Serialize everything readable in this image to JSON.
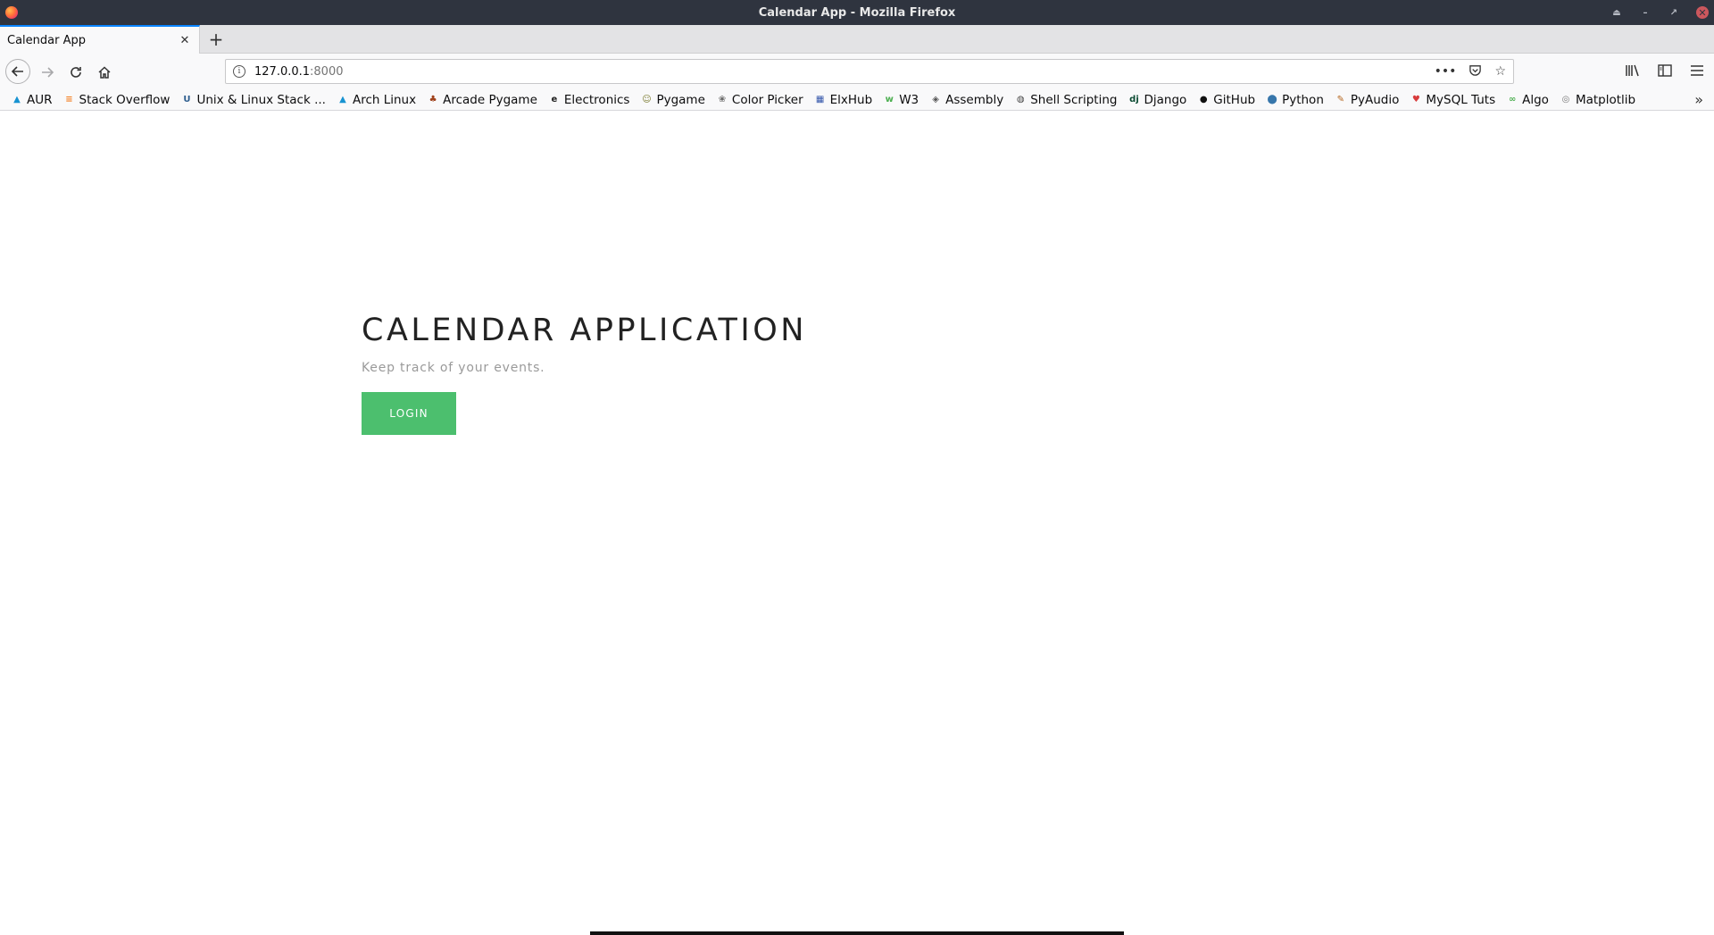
{
  "window": {
    "title": "Calendar App - Mozilla Firefox",
    "buttons": [
      "⏏",
      "–",
      "↗",
      "✕"
    ]
  },
  "tabs": [
    {
      "label": "Calendar App",
      "active": true
    }
  ],
  "newtab_label": "+",
  "urlbar": {
    "host": "127.0.0.1",
    "port": ":8000",
    "actions": [
      "•••",
      "pocket",
      "☆"
    ]
  },
  "bookmarks": [
    {
      "label": "AUR",
      "icon": "arch-icon",
      "color": "#1793d1",
      "glyph": "▲"
    },
    {
      "label": "Stack Overflow",
      "icon": "stackoverflow-icon",
      "color": "#f48024",
      "glyph": "≡"
    },
    {
      "label": "Unix & Linux Stack ...",
      "icon": "unix-linux-icon",
      "color": "#2e5e8e",
      "glyph": "U"
    },
    {
      "label": "Arch Linux",
      "icon": "arch-icon",
      "color": "#1793d1",
      "glyph": "▲"
    },
    {
      "label": "Arcade Pygame",
      "icon": "leaf-icon",
      "color": "#a0421c",
      "glyph": "♣"
    },
    {
      "label": "Electronics",
      "icon": "electronics-icon",
      "color": "#222222",
      "glyph": "e"
    },
    {
      "label": "Pygame",
      "icon": "pygame-icon",
      "color": "#7a7a2e",
      "glyph": "☺"
    },
    {
      "label": "Color Picker",
      "icon": "palette-icon",
      "color": "#6b6b6b",
      "glyph": "❀"
    },
    {
      "label": "ElxHub",
      "icon": "grid-icon",
      "color": "#3355aa",
      "glyph": "▦"
    },
    {
      "label": "W3",
      "icon": "w3-icon",
      "color": "#4caf50",
      "glyph": "w"
    },
    {
      "label": "Assembly",
      "icon": "diamond-icon",
      "color": "#555555",
      "glyph": "◈"
    },
    {
      "label": "Shell Scripting",
      "icon": "globe-icon",
      "color": "#444444",
      "glyph": "◍"
    },
    {
      "label": "Django",
      "icon": "django-icon",
      "color": "#0c4b33",
      "glyph": "dj"
    },
    {
      "label": "GitHub",
      "icon": "github-icon",
      "color": "#111111",
      "glyph": "●"
    },
    {
      "label": "Python",
      "icon": "python-icon",
      "color": "#3776ab",
      "glyph": "⬤"
    },
    {
      "label": "PyAudio",
      "icon": "pyaudio-icon",
      "color": "#b5651d",
      "glyph": "✎"
    },
    {
      "label": "MySQL Tuts",
      "icon": "mysql-icon",
      "color": "#d83c3c",
      "glyph": "♥"
    },
    {
      "label": "Algo",
      "icon": "algo-icon",
      "color": "#4caf50",
      "glyph": "∞"
    },
    {
      "label": "Matplotlib",
      "icon": "matplotlib-icon",
      "color": "#777777",
      "glyph": "◎"
    }
  ],
  "page": {
    "title": "CALENDAR APPLICATION",
    "subtitle": "Keep track of your events.",
    "login_label": "LOGIN",
    "accent_color": "#4cbf6e"
  }
}
